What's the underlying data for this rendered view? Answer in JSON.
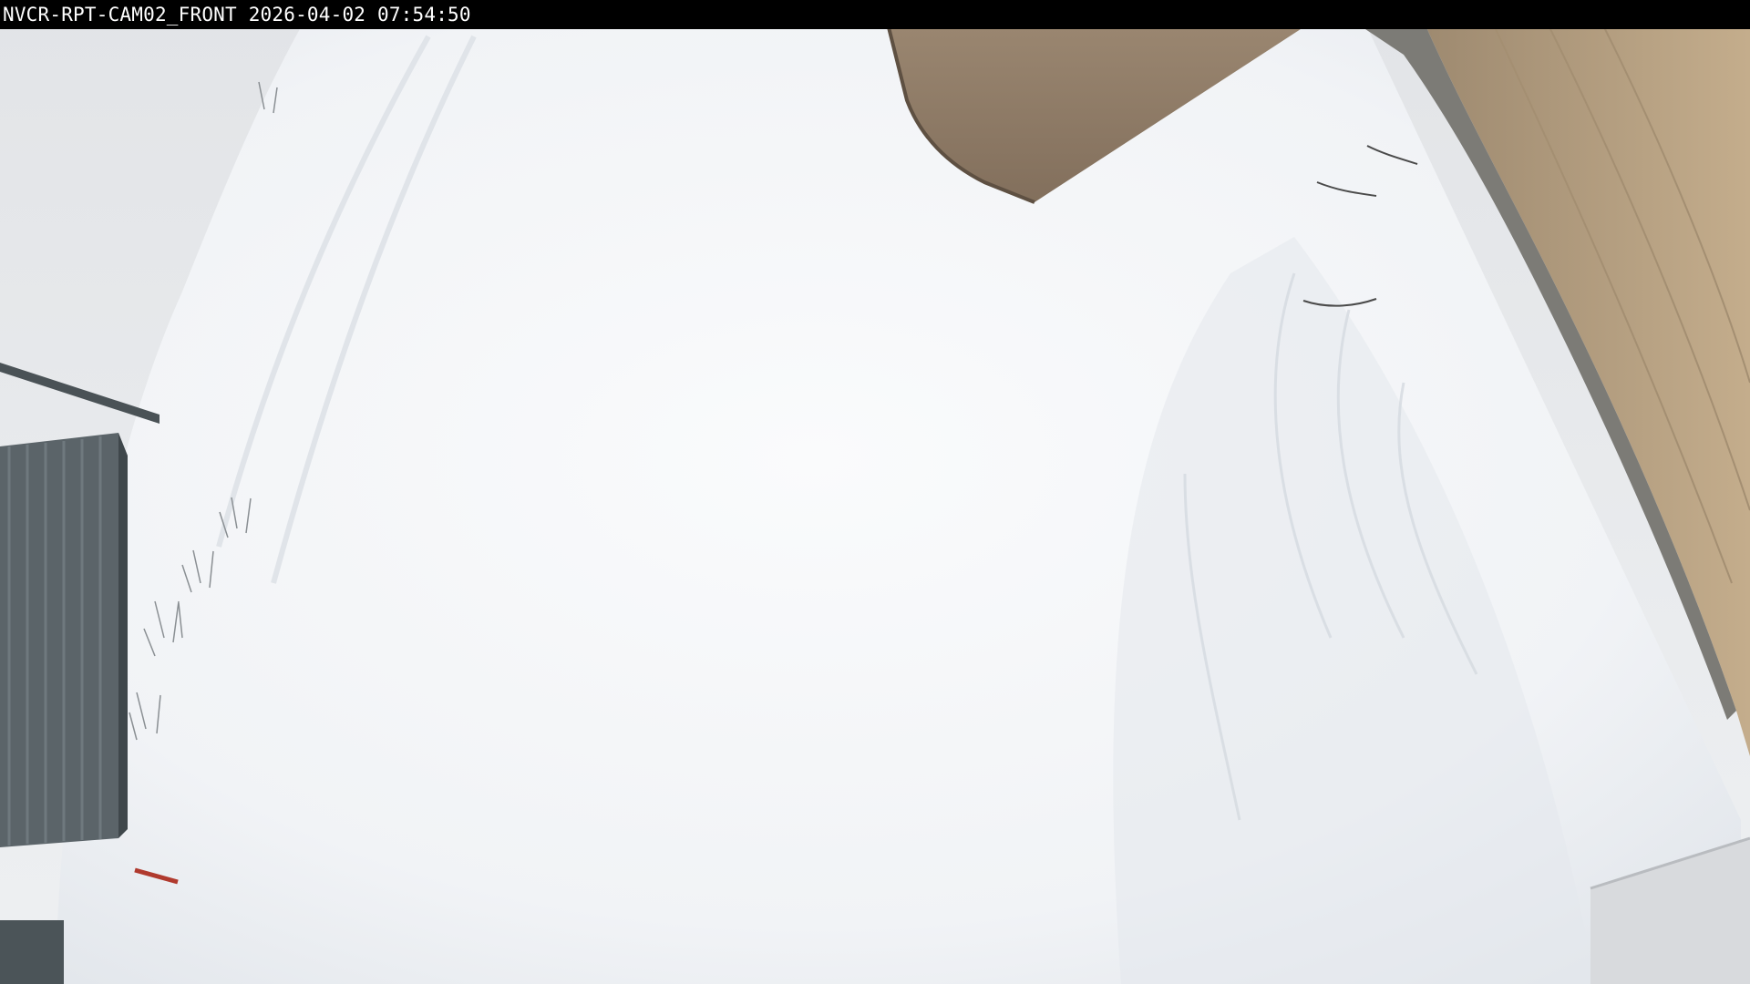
{
  "camera": {
    "osd_label": "NVCR-RPT-CAM02_FRONT 2026-04-02 07:54:50"
  },
  "scene": {
    "description_tags": [
      "snow-field",
      "building-wall",
      "overhang-roof",
      "fence",
      "dry-grass",
      "fog-sky"
    ],
    "colors": {
      "snow": "#f4f6f8",
      "snow_shadow": "#dfe3e8",
      "sky": "#e6e8eb",
      "roof": "#8f7b66",
      "wall": "#b7a07f",
      "fence": "#566066",
      "osd_bar": "#000000",
      "osd_text": "#ffffff"
    }
  }
}
